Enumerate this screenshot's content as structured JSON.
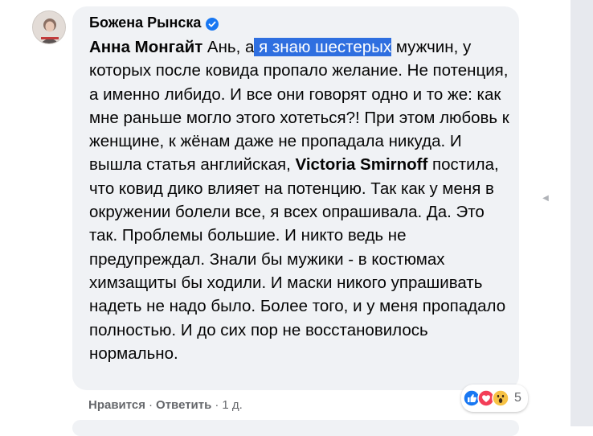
{
  "comment": {
    "author": "Божена Рынска",
    "verified_icon": "verified-badge-icon",
    "mention_1": "Анна Монгайт",
    "text_a": " Ань, а",
    "highlighted": " я знаю шестерых",
    "text_b": " мужчин, у которых после ковида пропало желание. Не потенция, а именно либидо. И все они говорят одно и то же: как мне раньше могло этого хотеться?! При этом любовь к женщине, к жёнам даже не пропадала никуда. И вышла статья английская, ",
    "mention_2": "Victoria Smirnoff",
    "text_c": " постила, что ковид дико влияет на потенцию. Так как у меня в окружении болели все, я всех опрашивала. Да. Это так. Проблемы большие. И никто ведь не предупреждал. Знали бы мужики - в костюмах химзащиты бы ходили. И маски никого упрашивать надеть не надо было. Более того, и у меня пропадало полностью. И до сих пор не восстановилось нормально."
  },
  "actions": {
    "like": "Нравится",
    "reply": "Ответить",
    "time": "1 д.",
    "separator": "·"
  },
  "reactions": {
    "icons": [
      "like-reaction-icon",
      "love-reaction-icon",
      "wow-reaction-icon"
    ],
    "count": "5"
  },
  "colors": {
    "bubble": "#f0f2f5",
    "highlight": "#2f6fe0",
    "link_gray": "#65676b",
    "verified": "#1877f2"
  }
}
